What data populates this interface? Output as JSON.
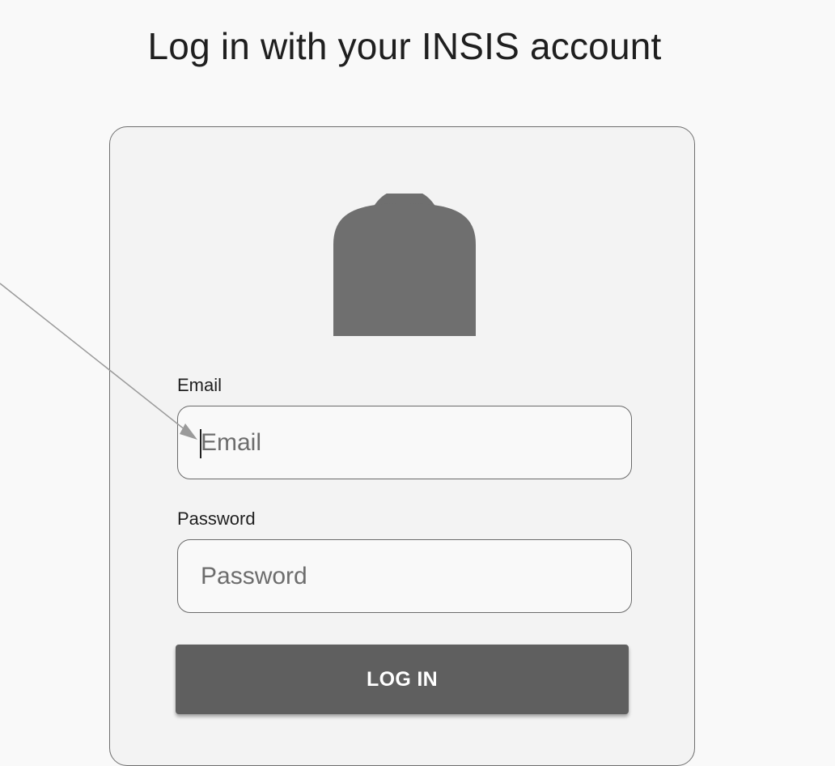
{
  "header": {
    "title": "Log in with your INSIS account"
  },
  "login_form": {
    "avatar_icon": "user-silhouette-icon",
    "email": {
      "label": "Email",
      "placeholder": "Email",
      "value": ""
    },
    "password": {
      "label": "Password",
      "placeholder": "Password",
      "value": ""
    },
    "submit_label": "LOG IN"
  },
  "colors": {
    "page_background": "#f9f9f9",
    "card_background": "#f3f3f3",
    "card_border": "#6e6e6e",
    "avatar": "#6f6f6f",
    "button_background": "#5f5f5f",
    "button_text": "#ffffff",
    "annotation_arrow": "#9a9a9a"
  }
}
